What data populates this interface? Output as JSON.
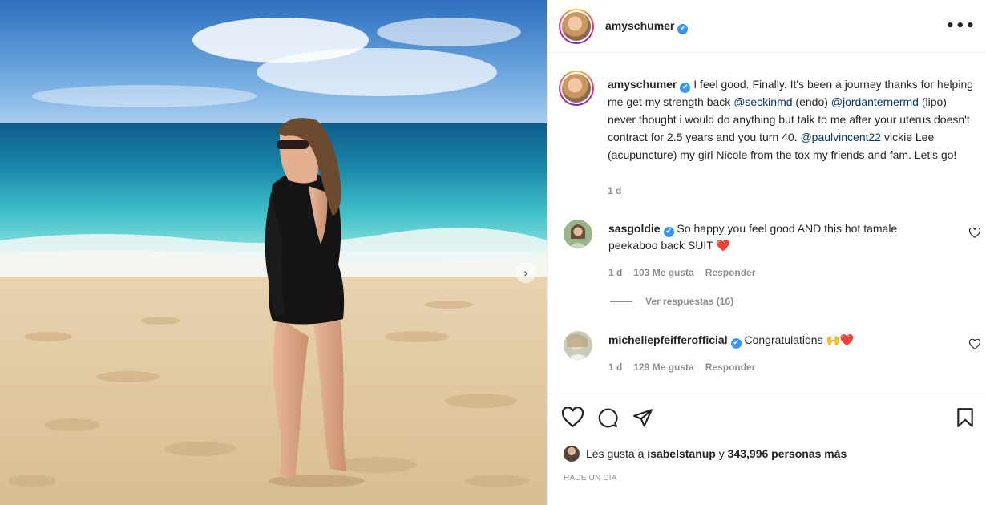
{
  "post": {
    "author": "amyschumer",
    "verified_mark": "✔",
    "more_label": "•••",
    "next_label": "›",
    "caption": {
      "author": "amyschumer",
      "parts": [
        {
          "text": "I feel good. Finally. It's been a journey thanks for helping me get my strength back ",
          "mention": false
        },
        {
          "text": "@seckinmd",
          "mention": true
        },
        {
          "text": " (endo) ",
          "mention": false
        },
        {
          "text": "@jordanternermd",
          "mention": true
        },
        {
          "text": " (lipo) never thought i would do anything but talk to me after your uterus doesn't contract for 2.5 years and you turn 40. ",
          "mention": false
        },
        {
          "text": "@paulvincent22",
          "mention": true
        },
        {
          "text": " vickie Lee (acupuncture) my girl Nicole from the tox my friends and fam. Let's go!",
          "mention": false
        }
      ],
      "age": "1 d"
    },
    "comments": [
      {
        "user": "sasgoldie",
        "text": "So happy you feel good AND this hot tamale peekaboo back SUIT",
        "emoji": "❤️",
        "age": "1 d",
        "likes": "103 Me gusta",
        "reply": "Responder",
        "view_replies": "Ver respuestas (16)"
      },
      {
        "user": "michellepfeifferofficial",
        "text": "Congratulations",
        "emoji": "🙌❤️",
        "age": "1 d",
        "likes": "129 Me gusta",
        "reply": "Responder"
      }
    ],
    "likes": {
      "prefix": "Les gusta a",
      "user": "isabelstanup",
      "middle": "y",
      "count": "343,996 personas más"
    },
    "time_ago": "HACE UN DÍA"
  },
  "icons": [
    "heart-icon",
    "comment-icon",
    "share-icon",
    "bookmark-icon",
    "verified-icon",
    "more-icon",
    "chevron-right-icon"
  ],
  "colors": {
    "mention": "#00376b",
    "verified": "#3897f0",
    "muted": "#8e8e8e",
    "heart_red": "#ed4956"
  }
}
